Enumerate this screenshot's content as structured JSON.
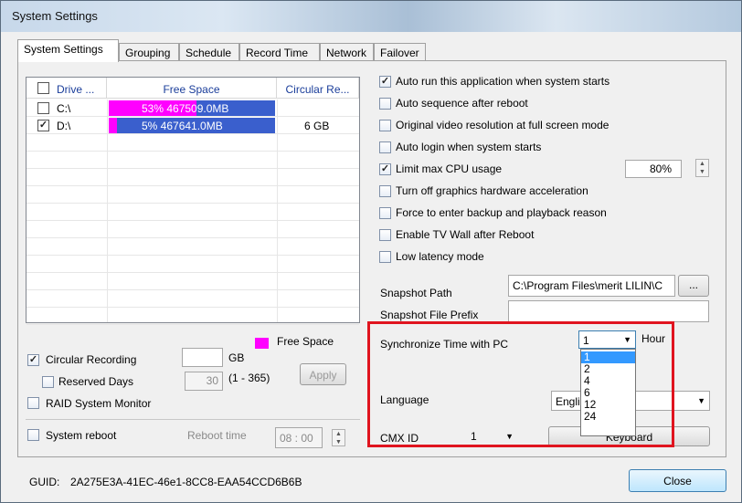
{
  "window": {
    "title": "System Settings"
  },
  "tabs": [
    "System Settings",
    "Grouping",
    "Schedule",
    "Record Time",
    "Network",
    "Failover"
  ],
  "drive_table": {
    "headers": [
      "Drive ...",
      "Free Space",
      "Circular Re..."
    ],
    "rows": [
      {
        "drive": "C:\\",
        "checked": false,
        "bar_text": "53%  467509.0MB",
        "free_pct": 0.53,
        "circular": ""
      },
      {
        "drive": "D:\\",
        "checked": true,
        "bar_text": "5%  467641.0MB",
        "free_pct": 0.05,
        "circular": "6 GB"
      }
    ]
  },
  "legend": {
    "label": "Free Space",
    "color": "#ff00ff"
  },
  "left_options": {
    "circular_recording": {
      "label": "Circular Recording",
      "checked": true,
      "value": "",
      "unit": "GB"
    },
    "reserved_days": {
      "label": "Reserved Days",
      "checked": false,
      "value": "30",
      "range": "(1 - 365)"
    },
    "apply_label": "Apply",
    "raid_monitor": {
      "label": "RAID System Monitor",
      "checked": false
    },
    "system_reboot": {
      "label": "System reboot",
      "checked": false
    },
    "reboot_time": {
      "label": "Reboot time",
      "value": "08 : 00"
    }
  },
  "right_options": [
    {
      "label": "Auto run this application when system starts",
      "checked": true
    },
    {
      "label": "Auto sequence after reboot",
      "checked": false
    },
    {
      "label": "Original video resolution at full screen mode",
      "checked": false
    },
    {
      "label": "Auto login when system starts",
      "checked": false
    },
    {
      "label": "Limit max CPU usage",
      "checked": true
    },
    {
      "label": "Turn off graphics hardware acceleration",
      "checked": false
    },
    {
      "label": "Force to enter backup and playback reason",
      "checked": false
    },
    {
      "label": "Enable TV Wall after Reboot",
      "checked": false
    },
    {
      "label": "Low latency mode",
      "checked": false
    }
  ],
  "cpu_limit": "80%",
  "snapshot": {
    "path_label": "Snapshot Path",
    "path_value": "C:\\Program Files\\merit LILIN\\C",
    "browse_label": "...",
    "prefix_label": "Snapshot File Prefix",
    "prefix_value": ""
  },
  "sync_time": {
    "label": "Synchronize Time with PC",
    "selected": "1",
    "unit": "Hour",
    "options": [
      "1",
      "2",
      "4",
      "6",
      "12",
      "24"
    ]
  },
  "language": {
    "label": "Language",
    "value": "Engli"
  },
  "cmx": {
    "label": "CMX ID",
    "value": "1"
  },
  "keyboard_label": "Keyboard",
  "guid": {
    "label": "GUID:",
    "value": "2A275E3A-41EC-46e1-8CC8-EAA54CCD6B6B"
  },
  "close_label": "Close"
}
